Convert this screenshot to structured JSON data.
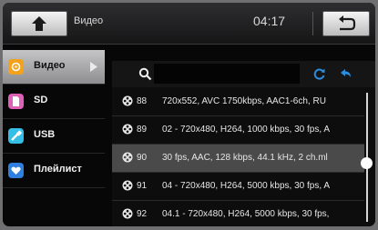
{
  "header": {
    "title": "Видео",
    "clock": "04:17",
    "home_icon": "home-icon",
    "back_icon": "return-icon"
  },
  "sidebar": {
    "items": [
      {
        "label": "Видео",
        "icon": "video-icon",
        "color": "#f4a21d",
        "active": true
      },
      {
        "label": "SD",
        "icon": "sd-card-icon",
        "color": "#e060b8",
        "active": false
      },
      {
        "label": "USB",
        "icon": "usb-icon",
        "color": "#35bfe6",
        "active": false
      },
      {
        "label": "Плейлист",
        "icon": "playlist-heart-icon",
        "color": "#2f7fe0",
        "active": false
      }
    ]
  },
  "toolbar": {
    "search_placeholder": "",
    "search_icon": "search-icon",
    "refresh_icon": "refresh-icon",
    "up_icon": "up-folder-icon",
    "accent": "#2a8fe0"
  },
  "list": {
    "rows": [
      {
        "num": "88",
        "title": "720x552, AVC 1750kbps, AAC1-6ch, RU",
        "selected": false
      },
      {
        "num": "89",
        "title": "02 - 720x480, H264, 1000 kbps, 30 fps, A",
        "selected": false
      },
      {
        "num": "90",
        "title": "30 fps, AAC, 128 kbps, 44.1 kHz, 2 ch.ml",
        "selected": true
      },
      {
        "num": "91",
        "title": "04 - 720x480, H264, 5000 kbps, 30 fps, A",
        "selected": false
      },
      {
        "num": "92",
        "title": "04.1 - 720x480, H264, 5000 kbps, 30 fps,",
        "selected": false
      }
    ],
    "scroll_position": 0.55
  }
}
